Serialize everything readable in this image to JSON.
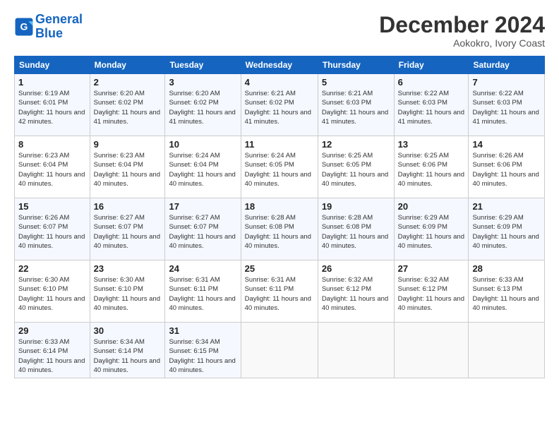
{
  "header": {
    "logo_line1": "General",
    "logo_line2": "Blue",
    "month": "December 2024",
    "location": "Aokokro, Ivory Coast"
  },
  "weekdays": [
    "Sunday",
    "Monday",
    "Tuesday",
    "Wednesday",
    "Thursday",
    "Friday",
    "Saturday"
  ],
  "weeks": [
    [
      {
        "day": "1",
        "sunrise": "6:19 AM",
        "sunset": "6:01 PM",
        "daylight": "11 hours and 42 minutes."
      },
      {
        "day": "2",
        "sunrise": "6:20 AM",
        "sunset": "6:02 PM",
        "daylight": "11 hours and 41 minutes."
      },
      {
        "day": "3",
        "sunrise": "6:20 AM",
        "sunset": "6:02 PM",
        "daylight": "11 hours and 41 minutes."
      },
      {
        "day": "4",
        "sunrise": "6:21 AM",
        "sunset": "6:02 PM",
        "daylight": "11 hours and 41 minutes."
      },
      {
        "day": "5",
        "sunrise": "6:21 AM",
        "sunset": "6:03 PM",
        "daylight": "11 hours and 41 minutes."
      },
      {
        "day": "6",
        "sunrise": "6:22 AM",
        "sunset": "6:03 PM",
        "daylight": "11 hours and 41 minutes."
      },
      {
        "day": "7",
        "sunrise": "6:22 AM",
        "sunset": "6:03 PM",
        "daylight": "11 hours and 41 minutes."
      }
    ],
    [
      {
        "day": "8",
        "sunrise": "6:23 AM",
        "sunset": "6:04 PM",
        "daylight": "11 hours and 40 minutes."
      },
      {
        "day": "9",
        "sunrise": "6:23 AM",
        "sunset": "6:04 PM",
        "daylight": "11 hours and 40 minutes."
      },
      {
        "day": "10",
        "sunrise": "6:24 AM",
        "sunset": "6:04 PM",
        "daylight": "11 hours and 40 minutes."
      },
      {
        "day": "11",
        "sunrise": "6:24 AM",
        "sunset": "6:05 PM",
        "daylight": "11 hours and 40 minutes."
      },
      {
        "day": "12",
        "sunrise": "6:25 AM",
        "sunset": "6:05 PM",
        "daylight": "11 hours and 40 minutes."
      },
      {
        "day": "13",
        "sunrise": "6:25 AM",
        "sunset": "6:06 PM",
        "daylight": "11 hours and 40 minutes."
      },
      {
        "day": "14",
        "sunrise": "6:26 AM",
        "sunset": "6:06 PM",
        "daylight": "11 hours and 40 minutes."
      }
    ],
    [
      {
        "day": "15",
        "sunrise": "6:26 AM",
        "sunset": "6:07 PM",
        "daylight": "11 hours and 40 minutes."
      },
      {
        "day": "16",
        "sunrise": "6:27 AM",
        "sunset": "6:07 PM",
        "daylight": "11 hours and 40 minutes."
      },
      {
        "day": "17",
        "sunrise": "6:27 AM",
        "sunset": "6:07 PM",
        "daylight": "11 hours and 40 minutes."
      },
      {
        "day": "18",
        "sunrise": "6:28 AM",
        "sunset": "6:08 PM",
        "daylight": "11 hours and 40 minutes."
      },
      {
        "day": "19",
        "sunrise": "6:28 AM",
        "sunset": "6:08 PM",
        "daylight": "11 hours and 40 minutes."
      },
      {
        "day": "20",
        "sunrise": "6:29 AM",
        "sunset": "6:09 PM",
        "daylight": "11 hours and 40 minutes."
      },
      {
        "day": "21",
        "sunrise": "6:29 AM",
        "sunset": "6:09 PM",
        "daylight": "11 hours and 40 minutes."
      }
    ],
    [
      {
        "day": "22",
        "sunrise": "6:30 AM",
        "sunset": "6:10 PM",
        "daylight": "11 hours and 40 minutes."
      },
      {
        "day": "23",
        "sunrise": "6:30 AM",
        "sunset": "6:10 PM",
        "daylight": "11 hours and 40 minutes."
      },
      {
        "day": "24",
        "sunrise": "6:31 AM",
        "sunset": "6:11 PM",
        "daylight": "11 hours and 40 minutes."
      },
      {
        "day": "25",
        "sunrise": "6:31 AM",
        "sunset": "6:11 PM",
        "daylight": "11 hours and 40 minutes."
      },
      {
        "day": "26",
        "sunrise": "6:32 AM",
        "sunset": "6:12 PM",
        "daylight": "11 hours and 40 minutes."
      },
      {
        "day": "27",
        "sunrise": "6:32 AM",
        "sunset": "6:12 PM",
        "daylight": "11 hours and 40 minutes."
      },
      {
        "day": "28",
        "sunrise": "6:33 AM",
        "sunset": "6:13 PM",
        "daylight": "11 hours and 40 minutes."
      }
    ],
    [
      {
        "day": "29",
        "sunrise": "6:33 AM",
        "sunset": "6:14 PM",
        "daylight": "11 hours and 40 minutes."
      },
      {
        "day": "30",
        "sunrise": "6:34 AM",
        "sunset": "6:14 PM",
        "daylight": "11 hours and 40 minutes."
      },
      {
        "day": "31",
        "sunrise": "6:34 AM",
        "sunset": "6:15 PM",
        "daylight": "11 hours and 40 minutes."
      },
      null,
      null,
      null,
      null
    ]
  ]
}
